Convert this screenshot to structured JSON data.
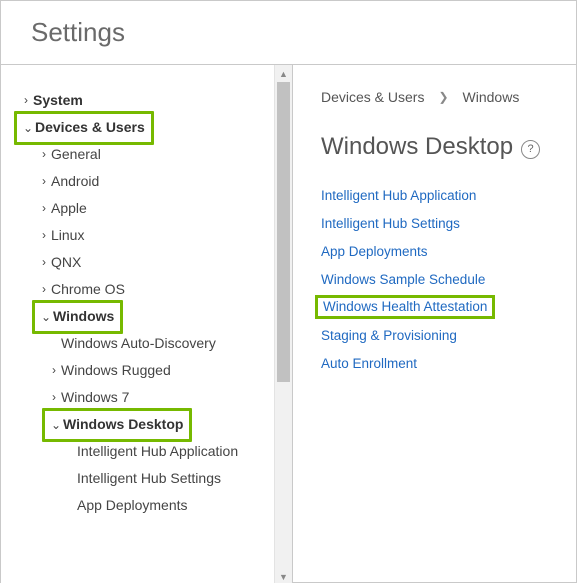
{
  "page": {
    "title": "Settings"
  },
  "sidebar": {
    "items": [
      {
        "label": "System",
        "indent": 0,
        "caret": "right",
        "bold": true,
        "highlight": false
      },
      {
        "label": "Devices & Users",
        "indent": 0,
        "caret": "down",
        "bold": true,
        "highlight": true
      },
      {
        "label": "General",
        "indent": 1,
        "caret": "right",
        "bold": false,
        "highlight": false
      },
      {
        "label": "Android",
        "indent": 1,
        "caret": "right",
        "bold": false,
        "highlight": false
      },
      {
        "label": "Apple",
        "indent": 1,
        "caret": "right",
        "bold": false,
        "highlight": false
      },
      {
        "label": "Linux",
        "indent": 1,
        "caret": "right",
        "bold": false,
        "highlight": false
      },
      {
        "label": "QNX",
        "indent": 1,
        "caret": "right",
        "bold": false,
        "highlight": false
      },
      {
        "label": "Chrome OS",
        "indent": 1,
        "caret": "right",
        "bold": false,
        "highlight": false
      },
      {
        "label": "Windows",
        "indent": 1,
        "caret": "down",
        "bold": true,
        "highlight": true
      },
      {
        "label": "Windows Auto-Discovery",
        "indent": 2,
        "caret": "none",
        "bold": false,
        "highlight": false
      },
      {
        "label": "Windows Rugged",
        "indent": 2,
        "caret": "right",
        "bold": false,
        "highlight": false
      },
      {
        "label": "Windows 7",
        "indent": 2,
        "caret": "right",
        "bold": false,
        "highlight": false
      },
      {
        "label": "Windows Desktop",
        "indent": 2,
        "caret": "down",
        "bold": true,
        "highlight": true
      },
      {
        "label": "Intelligent Hub Application",
        "indent": 3,
        "caret": "none",
        "bold": false,
        "highlight": false
      },
      {
        "label": "Intelligent Hub Settings",
        "indent": 3,
        "caret": "none",
        "bold": false,
        "highlight": false
      },
      {
        "label": "App Deployments",
        "indent": 3,
        "caret": "none",
        "bold": false,
        "highlight": false
      }
    ]
  },
  "main": {
    "breadcrumb": {
      "parent": "Devices & Users",
      "current": "Windows"
    },
    "heading": "Windows Desktop",
    "help_icon_glyph": "?",
    "links": [
      {
        "label": "Intelligent Hub Application",
        "highlight": false
      },
      {
        "label": "Intelligent Hub Settings",
        "highlight": false
      },
      {
        "label": "App Deployments",
        "highlight": false
      },
      {
        "label": "Windows Sample Schedule",
        "highlight": false
      },
      {
        "label": "Windows Health Attestation",
        "highlight": true
      },
      {
        "label": "Staging & Provisioning",
        "highlight": false
      },
      {
        "label": "Auto Enrollment",
        "highlight": false
      }
    ]
  },
  "glyphs": {
    "caret_right": "›",
    "caret_down": "⌄",
    "breadcrumb_sep": "❯",
    "scroll_up": "▲",
    "scroll_down": "▼"
  }
}
